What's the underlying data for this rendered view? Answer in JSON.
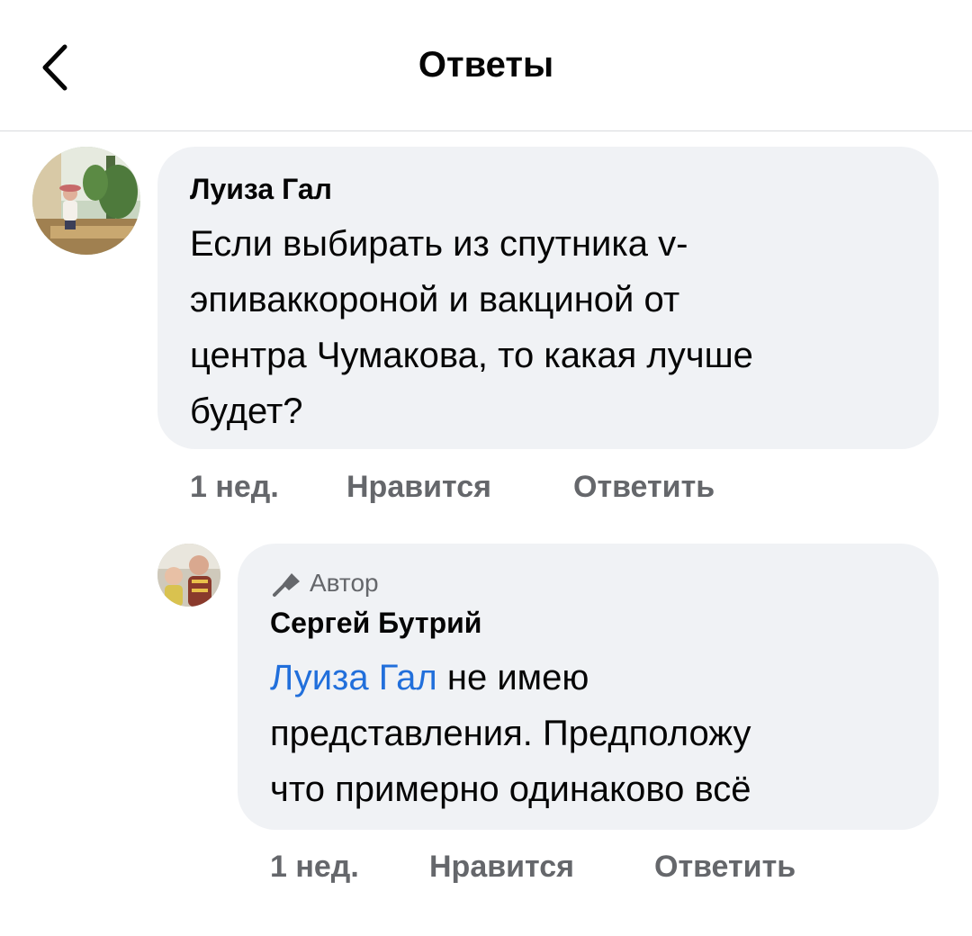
{
  "header": {
    "title": "Ответы",
    "back_icon": "chevron-left-icon"
  },
  "comment": {
    "author": "Луиза Гал",
    "text_lines": [
      "Если выбирать из спутника v-",
      "эпиваккороной и вакциной от",
      "центра Чумакова, то какая лучше",
      "будет?"
    ],
    "time": "1 нед.",
    "like_label": "Нравится",
    "reply_label": "Ответить"
  },
  "reply": {
    "badge_icon": "microphone-icon",
    "badge_label": "Автор",
    "author": "Сергей Бутрий",
    "mention": "Луиза Гал",
    "text_first": " не имею",
    "text_lines": [
      "представления. Предположу",
      "что примерно одинаково всё"
    ],
    "time": "1 нед.",
    "like_label": "Нравится",
    "reply_label": "Ответить"
  },
  "colors": {
    "bubble": "#f0f2f5",
    "meta": "#65676b",
    "mention": "#216fdb",
    "divider": "#d9dadd"
  }
}
